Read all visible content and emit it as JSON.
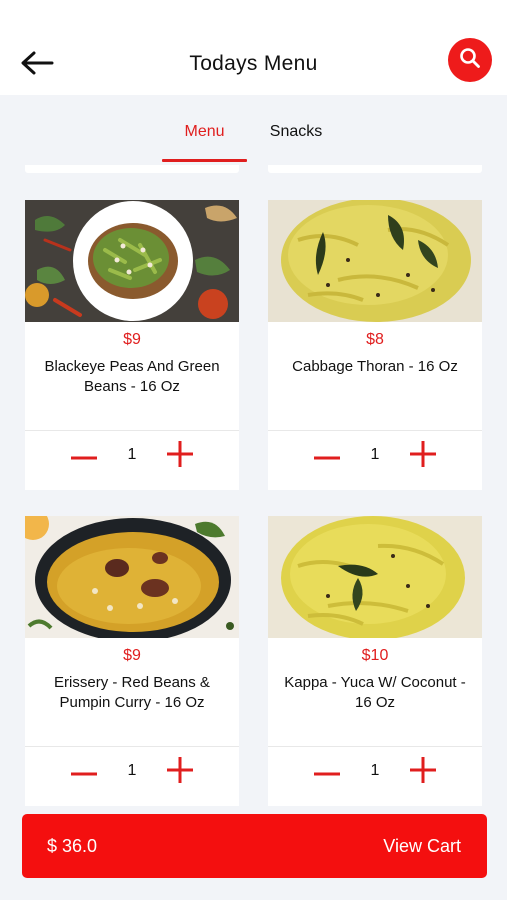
{
  "header": {
    "title": "Todays Menu",
    "back_icon": "arrow-left-icon",
    "search_icon": "search-icon"
  },
  "tabs": [
    {
      "label": "Menu",
      "active": true
    },
    {
      "label": "Snacks",
      "active": false
    }
  ],
  "items": [
    {
      "price": "$9",
      "name": "Blackeye Peas And Green Beans  - 16 Oz",
      "quantity": "1"
    },
    {
      "price": "$8",
      "name": "Cabbage Thoran  - 16 Oz",
      "quantity": "1"
    },
    {
      "price": "$9",
      "name": "Erissery - Red Beans & Pumpin Curry  - 16 Oz",
      "quantity": "1"
    },
    {
      "price": "$10",
      "name": "Kappa - Yuca W/ Coconut  - 16 Oz",
      "quantity": "1"
    }
  ],
  "cart": {
    "total": "$ 36.0",
    "button_label": "View Cart"
  },
  "colors": {
    "accent": "#e01e1e",
    "cart_bar": "#f40f0f",
    "background": "#f2f4f8"
  }
}
